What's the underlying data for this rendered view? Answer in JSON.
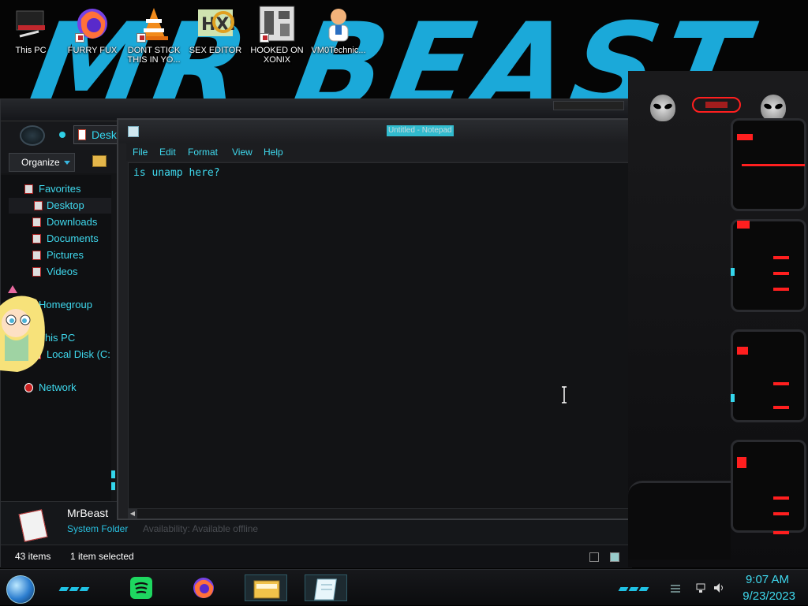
{
  "desktop": {
    "icons": [
      {
        "label": "This PC"
      },
      {
        "label": "FURRY FUX"
      },
      {
        "label": "DONT STICK THIS IN YO..."
      },
      {
        "label": "SEX EDITOR"
      },
      {
        "label": "HOOKED ON XONIX"
      },
      {
        "label": "VM0Technic..."
      }
    ],
    "wallpaper_text": "MR BEAST"
  },
  "explorer": {
    "address": "Desktop",
    "organize_label": "Organize",
    "nav": {
      "favorites": "Favorites",
      "desktop": "Desktop",
      "downloads": "Downloads",
      "documents": "Documents",
      "pictures": "Pictures",
      "videos": "Videos",
      "homegroup": "Homegroup",
      "this_pc": "This PC",
      "local_disk": "Local Disk (C:",
      "network": "Network"
    },
    "details": {
      "name": "MrBeast",
      "type": "System Folder",
      "availability": "Availability: Available offline"
    },
    "status": {
      "count": "43 items",
      "selected": "1 item selected"
    }
  },
  "notepad": {
    "title": "Untitled - Notepad",
    "menus": {
      "file": "File",
      "edit": "Edit",
      "format": "Format",
      "view": "View",
      "help": "Help"
    },
    "content": "is unamp here?"
  },
  "taskbar": {
    "time": "9:07 AM",
    "date": "9/23/2023"
  },
  "colors": {
    "accent": "#3fd9ee",
    "wallpaper_blue": "#1aa7d6",
    "alien_red": "#ff1f1f"
  }
}
